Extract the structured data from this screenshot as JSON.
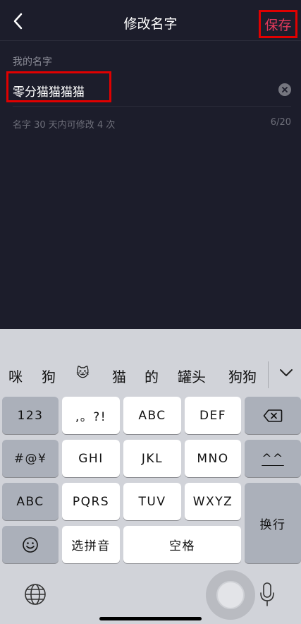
{
  "navbar": {
    "title": "修改名字",
    "save_label": "保存"
  },
  "form": {
    "label": "我的名字",
    "name_value": "零分猫猫猫猫",
    "hint": "名字 30 天内可修改 4 次",
    "counter": "6/20"
  },
  "keyboard": {
    "candidates": [
      "咪",
      "狗",
      "🐱",
      "猫",
      "的",
      "罐头",
      "狗狗"
    ],
    "keys": {
      "num": "123",
      "punct": ",。?!",
      "abc": "ABC",
      "def": "DEF",
      "symbols": "#@¥",
      "ghi": "GHI",
      "jkl": "JKL",
      "mno": "MNO",
      "emoticon": "^^",
      "abc_mode": "ABC",
      "pqrs": "PQRS",
      "tuv": "TUV",
      "wxyz": "WXYZ",
      "newline": "换行",
      "pinyin": "选拼音",
      "space": "空格"
    },
    "icons": [
      "chevron-down-icon",
      "backspace-icon",
      "emoji-icon",
      "globe-icon",
      "microphone-icon"
    ]
  },
  "colors": {
    "app_background": "#1c1d2b",
    "save_accent": "#e43a5c",
    "highlight_box": "#e00000",
    "keyboard_background": "#d1d3d9"
  }
}
